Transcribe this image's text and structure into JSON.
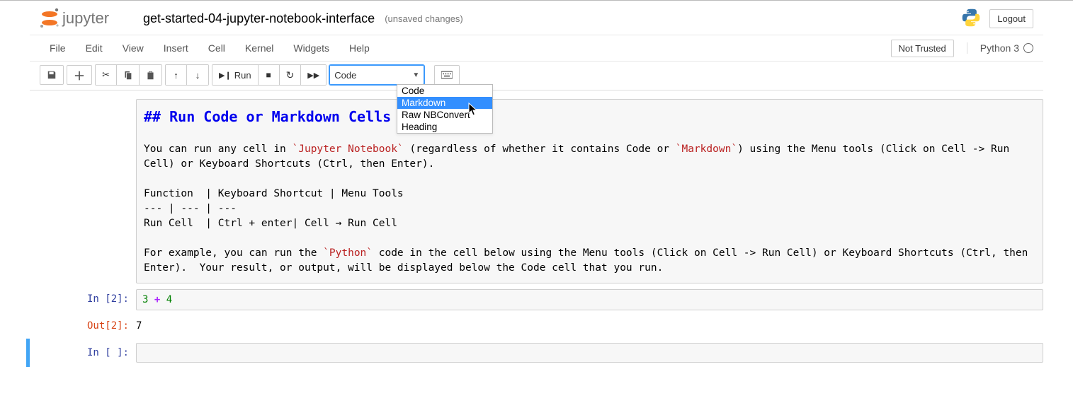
{
  "header": {
    "brand": "jupyter",
    "title": "get-started-04-jupyter-notebook-interface",
    "save_status": "(unsaved changes)",
    "logout": "Logout"
  },
  "menubar": {
    "items": [
      "File",
      "Edit",
      "View",
      "Insert",
      "Cell",
      "Kernel",
      "Widgets",
      "Help"
    ],
    "trust": "Not Trusted",
    "kernel": "Python 3"
  },
  "toolbar": {
    "run_label": "Run",
    "celltype_selected": "Code",
    "dropdown": [
      "Code",
      "Markdown",
      "Raw NBConvert",
      "Heading"
    ],
    "dropdown_highlight_index": 1
  },
  "cells": {
    "markdown": {
      "heading": "## Run Code or Markdown Cells",
      "p1_a": "You can run any cell in ",
      "p1_code1": "`Jupyter Notebook`",
      "p1_b": " (regardless of whether it contains Code or ",
      "p1_code2": "`Markdown`",
      "p1_c": ") using the Menu tools (Click on Cell -> Run Cell) or Keyboard Shortcuts (Ctrl, then Enter).",
      "table_header": "Function  | Keyboard Shortcut | Menu Tools",
      "table_sep": "--- | --- | ---",
      "table_row": "Run Cell  | Ctrl + enter| Cell → Run Cell",
      "p2_a": "For example, you can run the ",
      "p2_code1": "`Python`",
      "p2_b": " code in the cell below using the Menu tools (Click on Cell -> Run Cell) or Keyboard Shortcuts (Ctrl, then Enter).  Your result, or output, will be displayed below the Code cell that you run."
    },
    "code1": {
      "in_prompt": "In [2]:",
      "source_num1": "3",
      "source_op": " + ",
      "source_num2": "4",
      "out_prompt": "Out[2]:",
      "output": "7"
    },
    "code2": {
      "in_prompt": "In [ ]:"
    }
  }
}
